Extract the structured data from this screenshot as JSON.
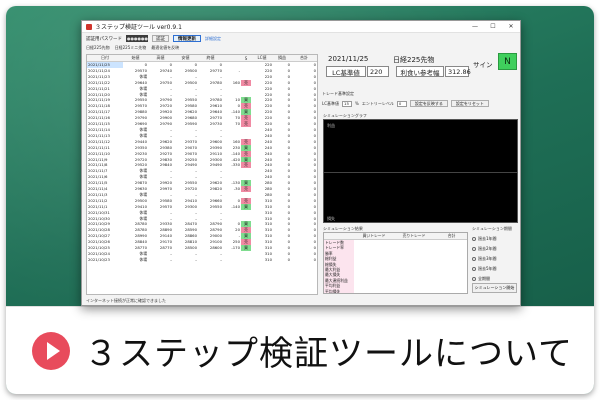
{
  "window": {
    "title": "３ステップ検証ツール ver0.9.1",
    "controls": [
      "—",
      "☐",
      "✕"
    ]
  },
  "toolbar": {
    "password_label": "認証用パスワード",
    "password_value": "●●●●●●",
    "auth_button": "認証",
    "update_button": "情報更新",
    "link": "詳細設定"
  },
  "toolbar2": [
    "日経225先物",
    "日経225ミニ先物",
    "最適化値を反映"
  ],
  "table": {
    "headers": [
      "日付",
      "始値",
      "高値",
      "安値",
      "終値",
      "S",
      "LC値",
      "損益",
      "合計"
    ],
    "rows": [
      [
        "2021/11/25",
        "0",
        "0",
        "0",
        "0",
        "",
        "220",
        "0",
        "0"
      ],
      [
        "2021/11/24",
        "29570",
        "29740",
        "29500",
        "29770",
        "-",
        "220",
        "0",
        "0"
      ],
      [
        "2021/11/23",
        "休場",
        "–",
        "–",
        "–",
        "",
        "220",
        "0",
        "0"
      ],
      [
        "2021/11/22",
        "29640",
        "29750",
        "29500",
        "29780",
        "160",
        "220",
        "0",
        "0"
      ],
      [
        "2021/11/21",
        "休場",
        "–",
        "–",
        "–",
        "",
        "220",
        "0",
        "0"
      ],
      [
        "2021/11/20",
        "休場",
        "–",
        "–",
        "–",
        "",
        "220",
        "0",
        "0"
      ],
      [
        "2021/11/19",
        "29550",
        "29790",
        "29550",
        "29780",
        "10",
        "220",
        "0",
        "0"
      ],
      [
        "2021/11/18",
        "29570",
        "29720",
        "29580",
        "29610",
        "0",
        "220",
        "0",
        "0"
      ],
      [
        "2021/11/17",
        "29880",
        "29920",
        "29620",
        "29640",
        "-140",
        "220",
        "0",
        "0"
      ],
      [
        "2021/11/16",
        "29790",
        "29900",
        "29680",
        "29770",
        "70",
        "220",
        "0",
        "0"
      ],
      [
        "2021/11/15",
        "29690",
        "29790",
        "29590",
        "29730",
        "70",
        "220",
        "0",
        "0"
      ],
      [
        "2021/11/14",
        "休場",
        "–",
        "–",
        "–",
        "",
        "240",
        "0",
        "0"
      ],
      [
        "2021/11/13",
        "休場",
        "–",
        "–",
        "–",
        "",
        "240",
        "0",
        "0"
      ],
      [
        "2021/11/12",
        "29440",
        "29620",
        "29370",
        "29600",
        "160",
        "240",
        "0",
        "0"
      ],
      [
        "2021/11/11",
        "29350",
        "29380",
        "29070",
        "29390",
        "230",
        "240",
        "0",
        "0"
      ],
      [
        "2021/11/10",
        "29230",
        "29270",
        "29070",
        "29110",
        "-140",
        "240",
        "0",
        "0"
      ],
      [
        "2021/11/9",
        "29720",
        "29830",
        "29250",
        "29300",
        "-420",
        "240",
        "0",
        "0"
      ],
      [
        "2021/11/8",
        "29520",
        "29840",
        "29490",
        "29490",
        "-330",
        "240",
        "0",
        "0"
      ],
      [
        "2021/11/7",
        "休場",
        "–",
        "–",
        "–",
        "",
        "240",
        "0",
        "0"
      ],
      [
        "2021/11/6",
        "休場",
        "–",
        "–",
        "–",
        "",
        "240",
        "0",
        "0"
      ],
      [
        "2021/11/5",
        "29870",
        "29920",
        "29550",
        "29620",
        "-130",
        "280",
        "0",
        "0"
      ],
      [
        "2021/11/4",
        "29630",
        "29970",
        "29720",
        "29820",
        "-30",
        "280",
        "0",
        "0"
      ],
      [
        "2021/11/3",
        "休場",
        "–",
        "–",
        "–",
        "",
        "280",
        "0",
        "0"
      ],
      [
        "2021/11/2",
        "29500",
        "29580",
        "29410",
        "29660",
        "0",
        "310",
        "0",
        "0"
      ],
      [
        "2021/11/1",
        "29410",
        "29570",
        "29300",
        "29550",
        "-140",
        "310",
        "0",
        "0"
      ],
      [
        "2021/10/31",
        "休場",
        "–",
        "–",
        "–",
        "",
        "310",
        "0",
        "0"
      ],
      [
        "2021/10/30",
        "休場",
        "–",
        "–",
        "–",
        "",
        "310",
        "0",
        "0"
      ],
      [
        "2021/10/29",
        "28780",
        "29330",
        "28470",
        "28790",
        "0",
        "310",
        "0",
        "0"
      ],
      [
        "2021/10/28",
        "28780",
        "28890",
        "28590",
        "28790",
        "20",
        "310",
        "0",
        "0"
      ],
      [
        "2021/10/27",
        "28990",
        "29140",
        "28860",
        "29000",
        "-",
        "310",
        "0",
        "0"
      ],
      [
        "2021/10/26",
        "28840",
        "29170",
        "28810",
        "29100",
        "250",
        "310",
        "0",
        "0"
      ],
      [
        "2021/10/25",
        "28770",
        "28770",
        "28500",
        "28600",
        "-170",
        "310",
        "0",
        "0"
      ],
      [
        "2021/10/24",
        "休場",
        "–",
        "–",
        "–",
        "",
        "310",
        "0",
        "0"
      ],
      [
        "2021/10/23",
        "休場",
        "–",
        "–",
        "–",
        "",
        "310",
        "0",
        "0"
      ]
    ],
    "signals": [
      "",
      "",
      "",
      "売",
      "",
      "",
      "買",
      "売",
      "買",
      "売",
      "売",
      "",
      "",
      "売",
      "買",
      "売",
      "買",
      "売",
      "",
      "",
      "買",
      "売",
      "",
      "売",
      "買",
      "",
      "",
      "買",
      "売",
      "買",
      "売",
      "買",
      "",
      ""
    ]
  },
  "info": {
    "date": "2021/11/25",
    "future_label": "日経225先物",
    "lc_label": "LC基準値",
    "lc_value": "220",
    "stop_label": "利食い参考幅",
    "stop_value": "312.86",
    "sign_label": "サイン",
    "sign_value": "N"
  },
  "settings": {
    "title": "トレード基準設定",
    "lc_label": "LC基準値",
    "lc_value": "15",
    "unit": "%",
    "level_label": "エントリーレベル",
    "level_value": "0",
    "apply_button": "設定を反映する",
    "reset_button": "設定をリセット"
  },
  "graph": {
    "title": "シミュレーショングラフ",
    "top_label": "利益",
    "bottom_label": "損失"
  },
  "simulation": {
    "title": "シミュレーション結果",
    "headers": [
      "",
      "買いトレード",
      "売りトレード",
      "合計"
    ],
    "rows": [
      "トレード数",
      "トレード率",
      "勝率",
      "総利益",
      "総損失",
      "最大利益",
      "最大損失",
      "最大連続利益",
      "平均利益",
      "平均損失",
      "利益率",
      "PF"
    ]
  },
  "period": {
    "title": "シミュレーション期間",
    "options": [
      "過去1年間",
      "過去2年間",
      "過去3年間",
      "過去5年間",
      "全期間"
    ],
    "start_button": "シミュレーション開始"
  },
  "status": "インターネット接続が正常に確認できました",
  "banner": {
    "title": "３ステップ検証ツールについて",
    "accent": "#e84b5c"
  }
}
